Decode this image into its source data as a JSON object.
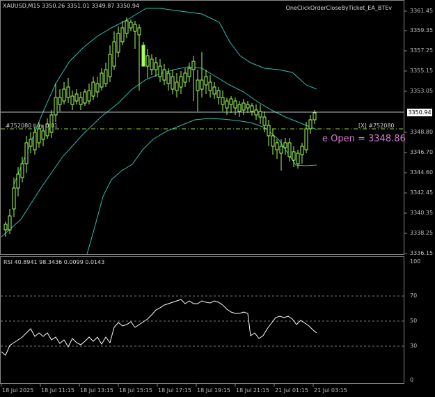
{
  "main": {
    "symbol_header": "XAUUSD,M15  3350.26 3351.01 3349.87 3350.94",
    "ea_name": "OneClickOrderCloseByTicket_EA_BTEv",
    "price_label": "3350.94",
    "order_left_label": "#752080 buy 0.01",
    "order_right_label": "[X] #752080",
    "open_label": "e Open  = 3348.86",
    "y_ticks": [
      "3361.45",
      "3359.35",
      "3357.25",
      "3355.15",
      "3353.05",
      "3350.94",
      "3348.80",
      "3346.70",
      "3344.60",
      "3342.45",
      "3340.35",
      "3338.25",
      "3336.15"
    ]
  },
  "rsi": {
    "header": "RSI  40.8941 98.3436 0.0099 0.0143",
    "y_ticks": [
      "100",
      "70",
      "50",
      "30",
      "0"
    ]
  },
  "x_ticks": [
    "18 Jul 2025",
    "18 Jul 11:15",
    "18 Jul 13:15",
    "18 Jul 15:15",
    "18 Jul 17:15",
    "18 Jul 19:15",
    "18 Jul 21:15",
    "21 Jul 01:15",
    "21 Jul 03:15"
  ],
  "colors": {
    "background": "#000000",
    "candle": "#a6ff59",
    "bands": "#2bbfb1",
    "open_line": "#8fd33a",
    "open_label": "#d77ad0",
    "price_line": "#b7bfc5",
    "grid": "#6a6a6a",
    "rsi_line": "#ffffff"
  }
}
